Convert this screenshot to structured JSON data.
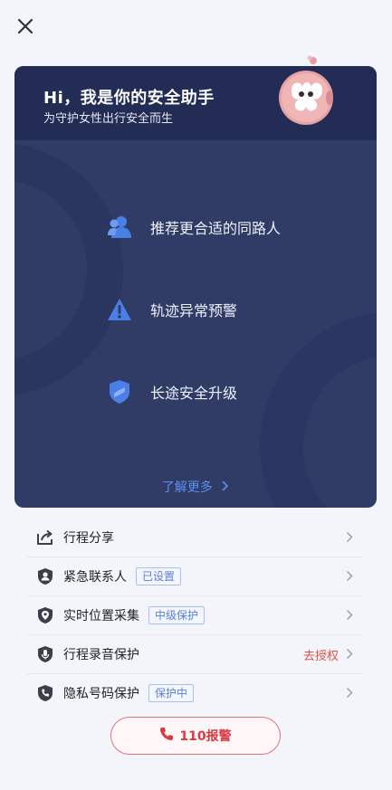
{
  "card": {
    "title": "Hi，我是你的安全助手",
    "subtitle": "为守护女性出行安全而生",
    "features": [
      {
        "label": "推荐更合适的同路人",
        "icon": "people-icon"
      },
      {
        "label": "轨迹异常预警",
        "icon": "warning-icon"
      },
      {
        "label": "长途安全升级",
        "icon": "shield-icon"
      }
    ],
    "learn_more": "了解更多"
  },
  "list": [
    {
      "label": "行程分享",
      "icon": "share-icon"
    },
    {
      "label": "紧急联系人",
      "icon": "contact-shield-icon",
      "tag": "已设置"
    },
    {
      "label": "实时位置采集",
      "icon": "location-shield-icon",
      "tag": "中级保护"
    },
    {
      "label": "行程录音保护",
      "icon": "microphone-shield-icon",
      "action": "去授权"
    },
    {
      "label": "隐私号码保护",
      "icon": "phone-shield-icon",
      "tag": "保护中"
    }
  ],
  "call_button": {
    "label": "110报警",
    "icon": "phone-icon"
  },
  "colors": {
    "accent_blue": "#4a7fe8",
    "alert_red": "#d83a44",
    "card_bg": "#303c66"
  }
}
